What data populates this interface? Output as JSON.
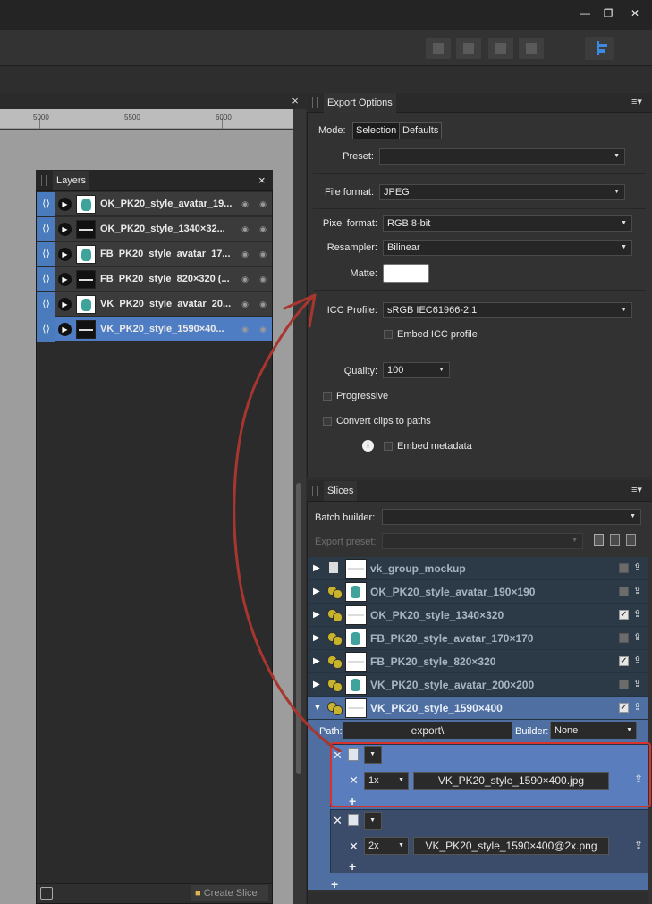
{
  "window": {
    "controls": [
      "—",
      "❐",
      "✕"
    ]
  },
  "document": {
    "close_glyph": "×",
    "ruler_labels": [
      "5000",
      "5500",
      "6000"
    ]
  },
  "layers_panel": {
    "title": "Layers",
    "close_glyph": "×",
    "rows": [
      {
        "name": "OK_PK20_style_avatar_19...",
        "thumb": "bird",
        "selected": false
      },
      {
        "name": "OK_PK20_style_1340×32...",
        "thumb": "dark",
        "selected": false
      },
      {
        "name": "FB_PK20_style_avatar_17...",
        "thumb": "bird",
        "selected": false
      },
      {
        "name": "FB_PK20_style_820×320 (...",
        "thumb": "dark",
        "selected": false
      },
      {
        "name": "VK_PK20_style_avatar_20...",
        "thumb": "bird",
        "selected": false
      },
      {
        "name": "VK_PK20_style_1590×40...",
        "thumb": "dark",
        "selected": true
      }
    ],
    "create_slice_label": "Create Slice"
  },
  "export_options": {
    "title": "Export Options",
    "mode_label": "Mode:",
    "mode_options": [
      "Selection",
      "Defaults"
    ],
    "mode_selected": "Selection",
    "preset_label": "Preset:",
    "preset_value": "",
    "file_format_label": "File format:",
    "file_format_value": "JPEG",
    "pixel_format_label": "Pixel format:",
    "pixel_format_value": "RGB 8-bit",
    "resampler_label": "Resampler:",
    "resampler_value": "Bilinear",
    "matte_label": "Matte:",
    "matte_color": "#ffffff",
    "icc_profile_label": "ICC Profile:",
    "icc_profile_value": "sRGB IEC61966-2.1",
    "embed_icc_label": "Embed ICC profile",
    "quality_label": "Quality:",
    "quality_value": "100",
    "progressive_label": "Progressive",
    "convert_clips_label": "Convert clips to paths",
    "embed_metadata_label": "Embed metadata"
  },
  "slices_panel": {
    "title": "Slices",
    "batch_builder_label": "Batch builder:",
    "batch_builder_value": "",
    "export_preset_label": "Export preset:",
    "rows": [
      {
        "name": "vk_group_mockup",
        "icon": "page",
        "thumb": "dark",
        "checked": false,
        "expanded": false
      },
      {
        "name": "OK_PK20_style_avatar_190×190",
        "icon": "dots",
        "thumb": "bird",
        "checked": false,
        "expanded": false
      },
      {
        "name": "OK_PK20_style_1340×320",
        "icon": "dots",
        "thumb": "dark",
        "checked": true,
        "expanded": false
      },
      {
        "name": "FB_PK20_style_avatar_170×170",
        "icon": "dots",
        "thumb": "bird",
        "checked": false,
        "expanded": false
      },
      {
        "name": "FB_PK20_style_820×320",
        "icon": "dots",
        "thumb": "dark",
        "checked": true,
        "expanded": false
      },
      {
        "name": "VK_PK20_style_avatar_200×200",
        "icon": "dots",
        "thumb": "bird",
        "checked": false,
        "expanded": false
      },
      {
        "name": "VK_PK20_style_1590×400",
        "icon": "dots",
        "thumb": "dark",
        "checked": true,
        "expanded": true
      }
    ],
    "path_label": "Path:",
    "path_value": "export\\",
    "builder_label": "Builder:",
    "builder_value": "None",
    "formats": [
      {
        "scale": "1x",
        "filename": "VK_PK20_style_1590×400.jpg"
      },
      {
        "scale": "2x",
        "filename": "VK_PK20_style_1590×400@2x.png"
      }
    ]
  }
}
